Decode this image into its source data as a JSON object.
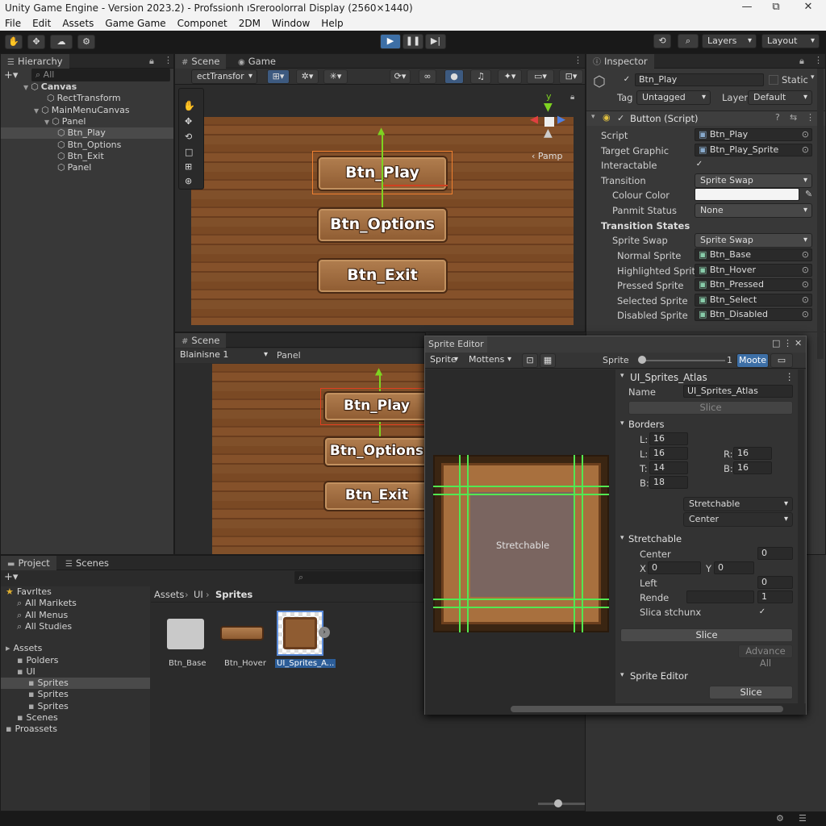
{
  "window": {
    "title": "Unity Game Engine - Version 2023.2) - Profssionh ıSreroolorral Display (2560×1440)",
    "minimize": "—",
    "maximize": "⧉",
    "close": "✕"
  },
  "menu": [
    "File",
    "Edit",
    "Assets",
    "Game Game",
    "Componet",
    "2DM",
    "Window",
    "Help"
  ],
  "toolbar": {
    "layers": "Layers",
    "layout": "Layout"
  },
  "hierarchy": {
    "tab": "Hierarchy",
    "search": "All",
    "items": [
      {
        "label": "Canvas",
        "depth": 0,
        "bold": true
      },
      {
        "label": "RectTransform",
        "depth": 2
      },
      {
        "label": "MainMenuCanvas",
        "depth": 1
      },
      {
        "label": "Panel",
        "depth": 2
      },
      {
        "label": "Btn_Play",
        "depth": 3,
        "selected": true
      },
      {
        "label": "Btn_Options",
        "depth": 3
      },
      {
        "label": "Btn_Exit",
        "depth": 3
      },
      {
        "label": "Panel",
        "depth": 3
      }
    ]
  },
  "scene": {
    "tab_scene": "Scene",
    "tab_game": "Game",
    "dropdown": "ectTransfor",
    "pamp": "Pamp",
    "axis_y": "y",
    "buttons": [
      "Btn_Play",
      "Btn_Options",
      "Btn_Exit"
    ]
  },
  "scene2": {
    "tab": "Scene",
    "left_dd": "Blainisne 1",
    "right_label": "Panel",
    "buttons": [
      "Btn_Play",
      "Btn_Options",
      "Btn_Exit"
    ]
  },
  "inspector": {
    "tab": "Inspector",
    "object_name": "Btn_Play",
    "static": "Static",
    "tag_label": "Tag",
    "tag_value": "Untagged",
    "layer_label": "Layer",
    "layer_value": "Default",
    "component": "Button (Script)",
    "rows": [
      {
        "label": "Script",
        "value": "Btn_Play",
        "type": "obj"
      },
      {
        "label": "Target Graphic",
        "value": "Btn_Play_Sprite",
        "type": "obj"
      },
      {
        "label": "Interactable",
        "value": "✓",
        "type": "check"
      },
      {
        "label": "Transition",
        "value": "Sprite Swap",
        "type": "dd"
      },
      {
        "label": "Colour Color",
        "value": "",
        "type": "color"
      },
      {
        "label": "Panmit Status",
        "value": "None",
        "type": "dd"
      }
    ],
    "transition_states": "Transition States",
    "sprite_swap_label": "Sprite Swap",
    "sprite_swap_value": "Sprite Swap",
    "sprites": [
      {
        "label": "Normal Sprite",
        "value": "Btn_Base"
      },
      {
        "label": "Highlighted Sprite",
        "value": "Btn_Hover"
      },
      {
        "label": "Pressed Sprite",
        "value": "Btn_Pressed"
      },
      {
        "label": "Selected Sprite",
        "value": "Btn_Select"
      },
      {
        "label": "Disabled Sprite",
        "value": "Btn_Disabled"
      }
    ]
  },
  "project": {
    "tab_project": "Project",
    "tab_scenes": "Scenes",
    "breadcrumb": [
      "Assets",
      "UI",
      "Sprites"
    ],
    "tree": [
      {
        "label": "Favrltes",
        "depth": 0,
        "icon": "★"
      },
      {
        "label": "All Marikets",
        "depth": 1,
        "icon": "⌕"
      },
      {
        "label": "All Menus",
        "depth": 1,
        "icon": "⌕"
      },
      {
        "label": "All Studies",
        "depth": 1,
        "icon": "⌕"
      },
      {
        "label": "Assets",
        "depth": 0,
        "icon": "▸"
      },
      {
        "label": "Polders",
        "depth": 1,
        "icon": "▪"
      },
      {
        "label": "UI",
        "depth": 1,
        "icon": "▪"
      },
      {
        "label": "Sprites",
        "depth": 2,
        "icon": "▪",
        "selected": true
      },
      {
        "label": "Sprites",
        "depth": 2,
        "icon": "▪"
      },
      {
        "label": "Sprites",
        "depth": 2,
        "icon": "▪"
      },
      {
        "label": "Scenes",
        "depth": 1,
        "icon": "▪"
      },
      {
        "label": "Proassets",
        "depth": 0,
        "icon": "▪"
      }
    ],
    "assets": [
      {
        "label": "Btn_Base"
      },
      {
        "label": "Btn_Hover"
      },
      {
        "label": "UI_Sprites_A..."
      }
    ]
  },
  "sprite_editor": {
    "title": "Sprite Editor",
    "dd1": "Sprite",
    "dd2": "Mottens",
    "sprite_label": "Sprite",
    "slider_value": "1",
    "mode_btn": "Moote",
    "stretchable": "Stretchable",
    "atlas": "UI_Sprites_Atlas",
    "name_label": "Name",
    "name_value": "UI_Sprites_Atlas",
    "slice_disabled": "Slice",
    "borders_title": "Borders",
    "borders": {
      "l1_label": "L:",
      "l1": "16",
      "l2_label": "L:",
      "l2": "16",
      "r_label": "R:",
      "r": "16",
      "t_label": "T:",
      "t": "14",
      "b1_label": "B:",
      "b1": "16",
      "b2_label": "B:",
      "b2": "18"
    },
    "dd_stretch": "Stretchable",
    "dd_center": "Center",
    "stretch_title": "Stretchable",
    "center_label": "Center",
    "center_value": "0",
    "x_label": "X",
    "x_value": "0",
    "y_label": "Y",
    "y_value": "0",
    "left_label": "Left",
    "left_value": "0",
    "rende_label": "Rende",
    "rende_value": "1",
    "slica_label": "Slica stchunx",
    "slica_check": "✓",
    "slice_btn": "Slice",
    "advance_btn": "Advance All",
    "sub_title": "Sprite Editor",
    "slice_btn2": "Slice"
  }
}
